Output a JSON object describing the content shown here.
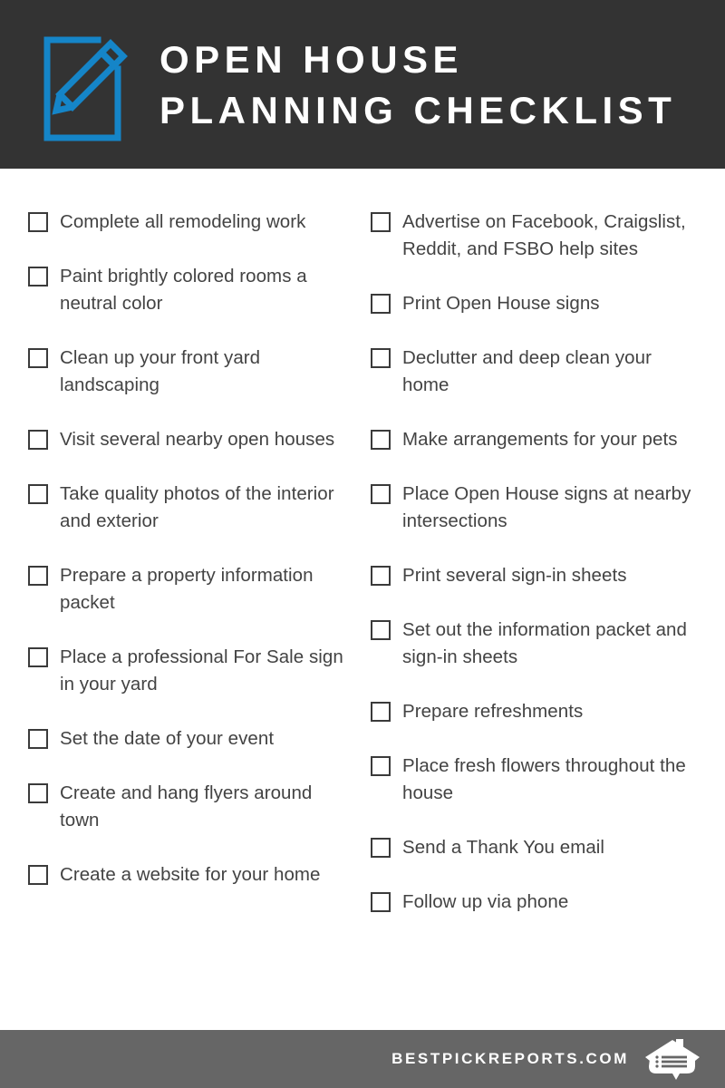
{
  "header": {
    "icon": "document-pencil-icon",
    "title_line1": "OPEN HOUSE",
    "title_line2": "PLANNING CHECKLIST",
    "background_color": "#333333",
    "icon_color": "#1585C8",
    "title_color": "#FFFFFF"
  },
  "checklist": {
    "checkbox_border_color": "#3B3B3B",
    "text_color": "#434343",
    "left_column": [
      {
        "label": "Complete all remodeling work",
        "checked": false
      },
      {
        "label": "Paint brightly colored rooms a neutral color",
        "checked": false
      },
      {
        "label": "Clean up your front yard landscaping",
        "checked": false
      },
      {
        "label": "Visit several nearby open houses",
        "checked": false
      },
      {
        "label": "Take quality photos of the interior and exterior",
        "checked": false
      },
      {
        "label": "Prepare a property information packet",
        "checked": false
      },
      {
        "label": "Place a professional For Sale sign in your yard",
        "checked": false
      },
      {
        "label": "Set the date of your event",
        "checked": false
      },
      {
        "label": "Create and hang flyers around town",
        "checked": false
      },
      {
        "label": "Create a website for your home",
        "checked": false
      }
    ],
    "right_column": [
      {
        "label": "Advertise on Facebook, Craigslist, Reddit, and FSBO help sites",
        "checked": false
      },
      {
        "label": "Print Open House signs",
        "checked": false
      },
      {
        "label": "Declutter and deep clean your home",
        "checked": false
      },
      {
        "label": "Make arrangements for your pets",
        "checked": false
      },
      {
        "label": "Place Open House signs at nearby intersections",
        "checked": false
      },
      {
        "label": "Print several sign-in sheets",
        "checked": false
      },
      {
        "label": "Set out the information packet and sign-in sheets",
        "checked": false
      },
      {
        "label": "Prepare refreshments",
        "checked": false
      },
      {
        "label": "Place fresh flowers throughout the house",
        "checked": false
      },
      {
        "label": "Send a Thank You email",
        "checked": false
      },
      {
        "label": "Follow up via phone",
        "checked": false
      }
    ]
  },
  "footer": {
    "text": "BESTPICKREPORTS.COM",
    "logo": "house-speech-bubble-logo",
    "background_color": "#666666",
    "text_color": "#FFFFFF"
  }
}
